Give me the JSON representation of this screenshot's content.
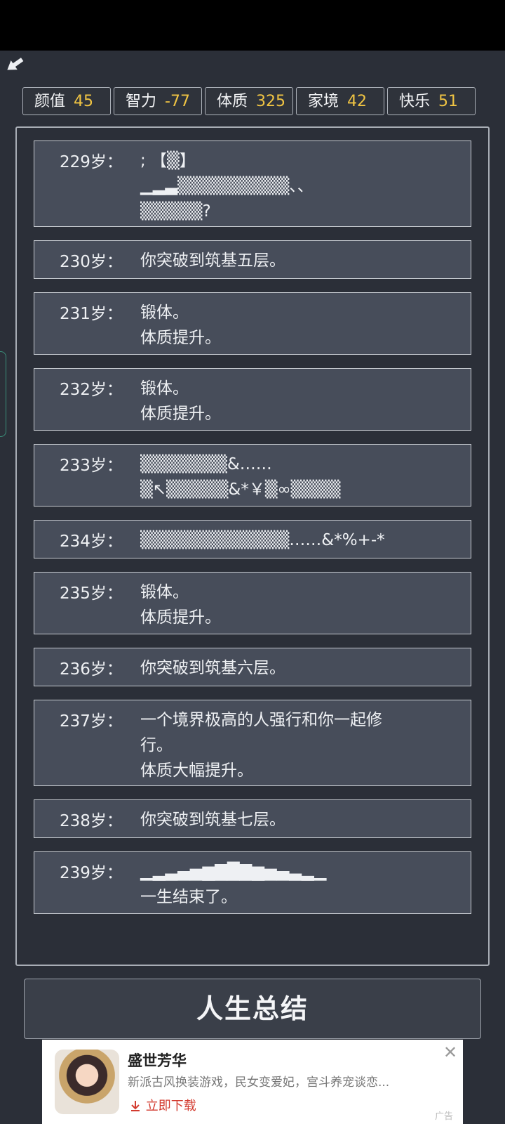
{
  "stats": [
    {
      "label": "颜值",
      "value": "45"
    },
    {
      "label": "智力",
      "value": "-77"
    },
    {
      "label": "体质",
      "value": "325"
    },
    {
      "label": "家境",
      "value": "42"
    },
    {
      "label": "快乐",
      "value": "51"
    }
  ],
  "entries": [
    {
      "age": "229岁：",
      "lines": [
        ";  【▒】",
        "▁▂▃▒▒▒▒▒▒▒▒▒、、",
        "▒▒▒▒▒?"
      ]
    },
    {
      "age": "230岁：",
      "lines": [
        "你突破到筑基五层。"
      ]
    },
    {
      "age": "231岁：",
      "lines": [
        "锻体。",
        "体质提升。"
      ]
    },
    {
      "age": "232岁：",
      "lines": [
        "锻体。",
        "体质提升。"
      ]
    },
    {
      "age": "233岁：",
      "lines": [
        "▒▒▒▒▒▒▒&……",
        "▒↖▒▒▒▒▒&*￥▒∞▒▒▒▒"
      ]
    },
    {
      "age": "234岁：",
      "lines": [
        "▒▒▒▒▒▒▒▒▒▒▒▒……&*%+-*"
      ]
    },
    {
      "age": "235岁：",
      "lines": [
        "锻体。",
        "体质提升。"
      ]
    },
    {
      "age": "236岁：",
      "lines": [
        "你突破到筑基六层。"
      ]
    },
    {
      "age": "237岁：",
      "lines": [
        "一个境界极高的人强行和你一起修",
        "行。",
        "体质大幅提升。"
      ]
    },
    {
      "age": "238岁：",
      "lines": [
        "你突破到筑基七层。"
      ]
    },
    {
      "age": "239岁：",
      "lines": [
        "▁▂▃▄▅▆▇█▇▆▅▄▃▂▁",
        "一生结束了。"
      ]
    }
  ],
  "summary_button": "人生总结",
  "ad": {
    "title": "盛世芳华",
    "description": "新派古风换装游戏，民女变爱妃，宫斗养宠谈恋...",
    "download": "立即下载",
    "tag": "广告",
    "close_icon": "close-icon"
  },
  "colors": {
    "stat_value": "#f0c443",
    "entry_bg": "#474d5a",
    "page_bg": "#2b2f38"
  }
}
